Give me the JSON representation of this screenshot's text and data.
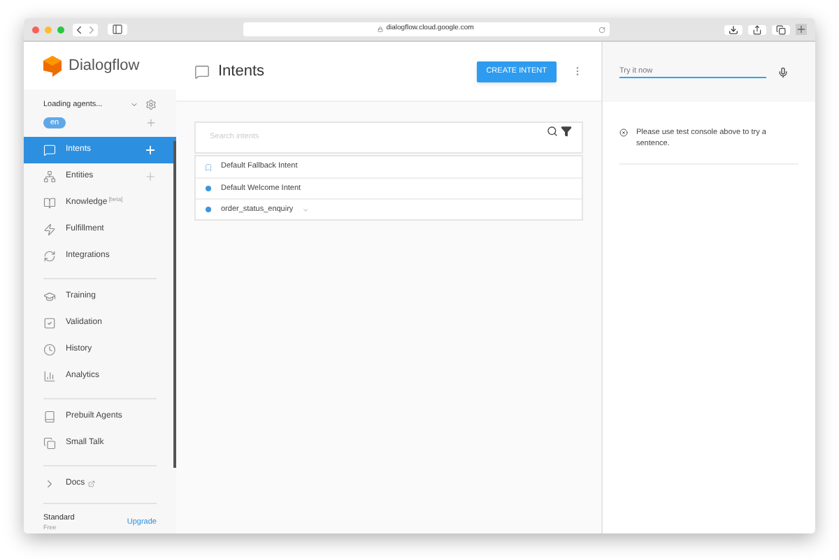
{
  "browser": {
    "url": "dialogflow.cloud.google.com"
  },
  "sidebar": {
    "logo": "Dialogflow",
    "agent": "Loading agents...",
    "language": "en",
    "sections": [
      [
        {
          "label": "Intents",
          "selected": true,
          "kind": "add"
        },
        {
          "label": "Entities",
          "selected": false,
          "kind": "add"
        },
        {
          "label": "Knowledge",
          "tag": "[beta]",
          "selected": false,
          "kind": "plain"
        },
        {
          "label": "Fulfillment",
          "selected": false,
          "kind": "plain"
        },
        {
          "label": "Integrations",
          "selected": false,
          "kind": "plain"
        }
      ],
      [
        {
          "label": "Training",
          "selected": false,
          "kind": "plain"
        },
        {
          "label": "Validation",
          "selected": false,
          "kind": "plain"
        },
        {
          "label": "History",
          "selected": false,
          "kind": "plain"
        },
        {
          "label": "Analytics",
          "selected": false,
          "kind": "plain"
        }
      ],
      [
        {
          "label": "Prebuilt Agents",
          "selected": false,
          "kind": "plain"
        },
        {
          "label": "Small Talk",
          "selected": false,
          "kind": "plain"
        }
      ],
      [
        {
          "label": "Docs",
          "selected": false,
          "kind": "external"
        }
      ]
    ],
    "plan": {
      "name": "Standard",
      "tier": "Free",
      "action": "Upgrade"
    }
  },
  "main": {
    "title": "Intents",
    "button": "CREATE INTENT",
    "search": {
      "placeholder": "Search intents"
    },
    "intents": [
      {
        "name": "Default Fallback Intent",
        "kind": "fallback"
      },
      {
        "name": "Default Welcome Intent",
        "kind": "intent"
      },
      {
        "name": "order_status_enquiry",
        "kind": "parent"
      }
    ]
  },
  "console": {
    "placeholder": "Try it now",
    "message": "Please use test console above to try a sentence."
  }
}
